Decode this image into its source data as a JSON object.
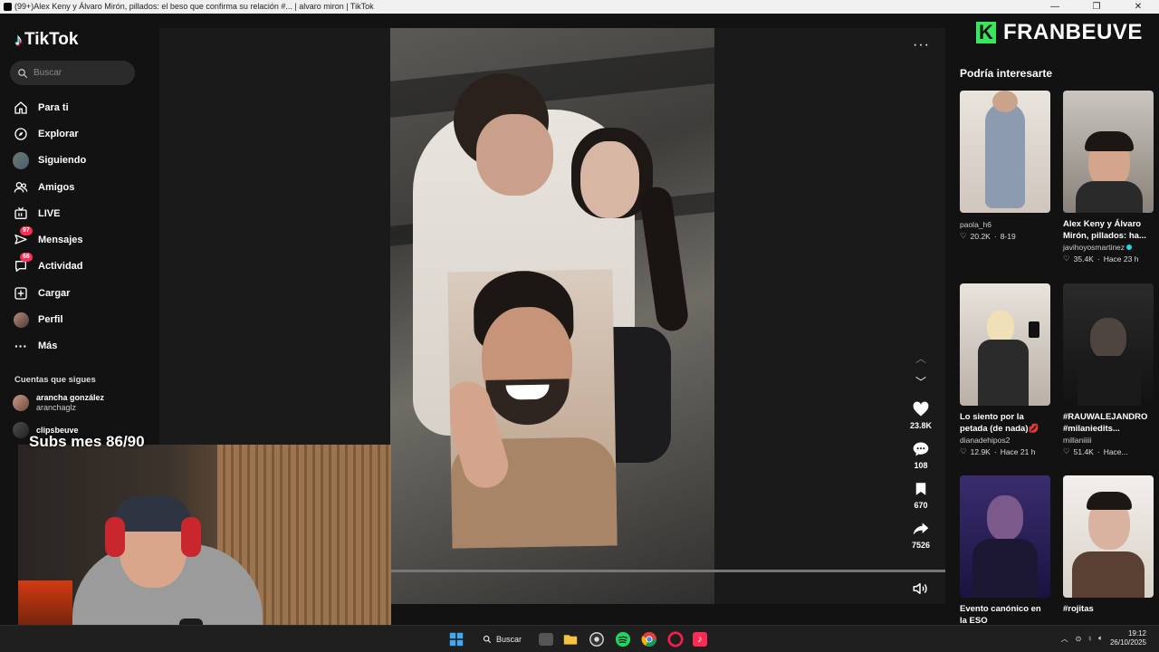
{
  "window": {
    "title": "(99+)Alex Keny y Álvaro Mirón, pillados: el beso que confirma su relación #... | alvaro miron | TikTok",
    "controls": [
      "—",
      "❐",
      "✕"
    ]
  },
  "sidebar": {
    "logo": "TikTok",
    "search_placeholder": "Buscar",
    "items": [
      {
        "label": "Para ti",
        "icon": "home-icon"
      },
      {
        "label": "Explorar",
        "icon": "compass-icon"
      },
      {
        "label": "Siguiendo",
        "icon": "following-avatar"
      },
      {
        "label": "Amigos",
        "icon": "friends-icon"
      },
      {
        "label": "LIVE",
        "icon": "live-icon"
      },
      {
        "label": "Mensajes",
        "icon": "messages-icon",
        "badge": "97"
      },
      {
        "label": "Actividad",
        "icon": "activity-icon",
        "badge": "66"
      },
      {
        "label": "Cargar",
        "icon": "upload-icon"
      },
      {
        "label": "Perfil",
        "icon": "profile-avatar"
      },
      {
        "label": "Más",
        "icon": "more-icon"
      }
    ],
    "following_title": "Cuentas que sigues",
    "following": [
      {
        "name": "arancha gonzález",
        "handle": "aranchaglz"
      },
      {
        "name": "clipsbeuve",
        "handle": ""
      }
    ]
  },
  "video": {
    "actions": {
      "likes": "23.8K",
      "comments": "108",
      "saves": "670",
      "shares": "7526"
    },
    "progress": 0
  },
  "overlay": {
    "subs": "Subs mes 86/90",
    "brand": "FRANBEUVE",
    "brand_letter": "K"
  },
  "recommendations": {
    "title": "Podría interesarte",
    "cards": [
      {
        "title": "",
        "author": "paola_h6",
        "likes": "20.2K",
        "time": "8-19"
      },
      {
        "title": "Alex Keny y Álvaro Mirón, pillados: ha...",
        "author": "javihoyosmartinez",
        "likes": "35.4K",
        "time": "Hace 23 h",
        "verified": true
      },
      {
        "title": "Lo siento por la petada (de nada)💋",
        "author": "dianadehipos2",
        "likes": "12.9K",
        "time": "Hace 21 h"
      },
      {
        "title": "#RAUWALEJANDRO #milaniedits...",
        "author": "millaniiiii",
        "likes": "51.4K",
        "time": "Hace..."
      },
      {
        "title": "Evento canónico en la ESO",
        "author": "",
        "likes": "",
        "time": ""
      },
      {
        "title": "#rojitas",
        "author": "",
        "likes": "",
        "time": ""
      }
    ]
  },
  "taskbar": {
    "search": "Buscar",
    "time": "19:12",
    "date": "26/10/2025"
  }
}
